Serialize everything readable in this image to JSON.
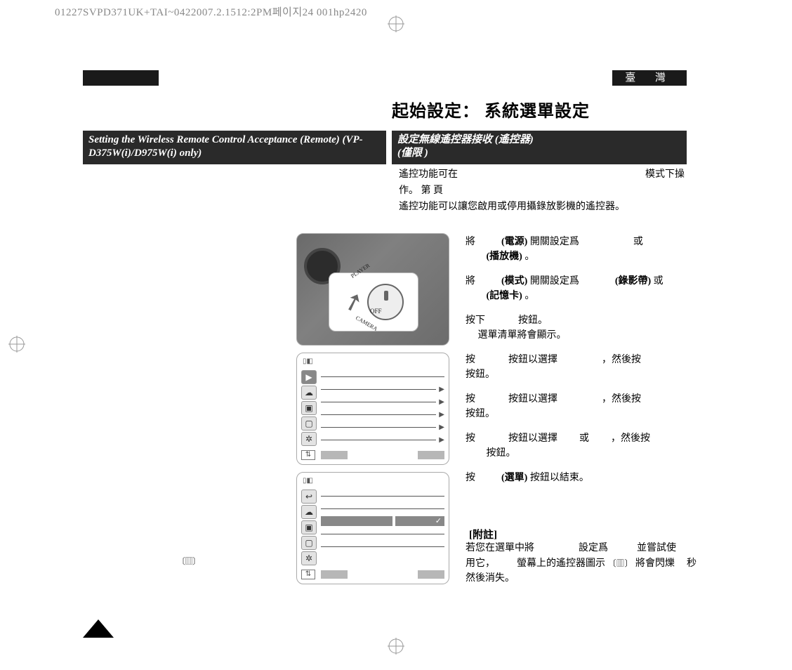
{
  "meta": {
    "header_stamp": "01227SVPD371UK+TAI~0422007.2.1512:2PM페이지24 001hp2420"
  },
  "lang_right": "臺 灣",
  "title_zh": "起始設定： 系統選單設定",
  "subheading_en": "Setting the Wireless Remote Control Acceptance (Remote) (VP-D375W(i)/D975W(i) only)",
  "subheading_zh_line1": "設定無線遙控器接收 (遙控器)",
  "subheading_zh_line2": "(僅限                                                    )",
  "intro": {
    "l1a": "遙控功能可在",
    "l1b": "模式下操",
    "l2": "作。   第      頁",
    "l3": "遙控功能可以讓您啟用或停用攝錄放影機的遙控器。"
  },
  "step1": {
    "a": "將",
    "b": "(電源)",
    "c": "開關設定爲",
    "d": "或",
    "e": "(播放機)",
    "f": "。"
  },
  "step2": {
    "a": "將",
    "b": "(模式)",
    "c": "開關設定爲",
    "d": "(錄影帶)",
    "e": "或",
    "f": "(記憶卡)",
    "g": "。"
  },
  "step3": {
    "a": "按下",
    "b": "按鈕。",
    "c": "選單清單將會顯示。"
  },
  "step4": {
    "a": "按",
    "b": "按鈕以選擇",
    "c": "，然後按",
    "d": "按鈕。"
  },
  "step5": {
    "a": "按",
    "b": "按鈕以選擇",
    "c": "，然後按",
    "d": "按鈕。"
  },
  "step6": {
    "a": "按",
    "b": "按鈕以選擇",
    "c": "或",
    "d": "，然後按",
    "e": "按鈕。"
  },
  "step7": {
    "a": "按",
    "b": "(選單)",
    "c": "按鈕以結束。"
  },
  "note_h": "[附註]",
  "note": {
    "l1a": "若您在選單中將",
    "l1b": "設定爲",
    "l1c": "並嘗試使",
    "l2a": "用它，",
    "l2b": "螢幕上的遙控器圖示",
    "l2c": "將會閃爍",
    "l2d": "秒",
    "l3": "然後消失。"
  },
  "illus_labels": {
    "player": "PLAYER",
    "off": "OFF",
    "camera": "CAMERA"
  }
}
